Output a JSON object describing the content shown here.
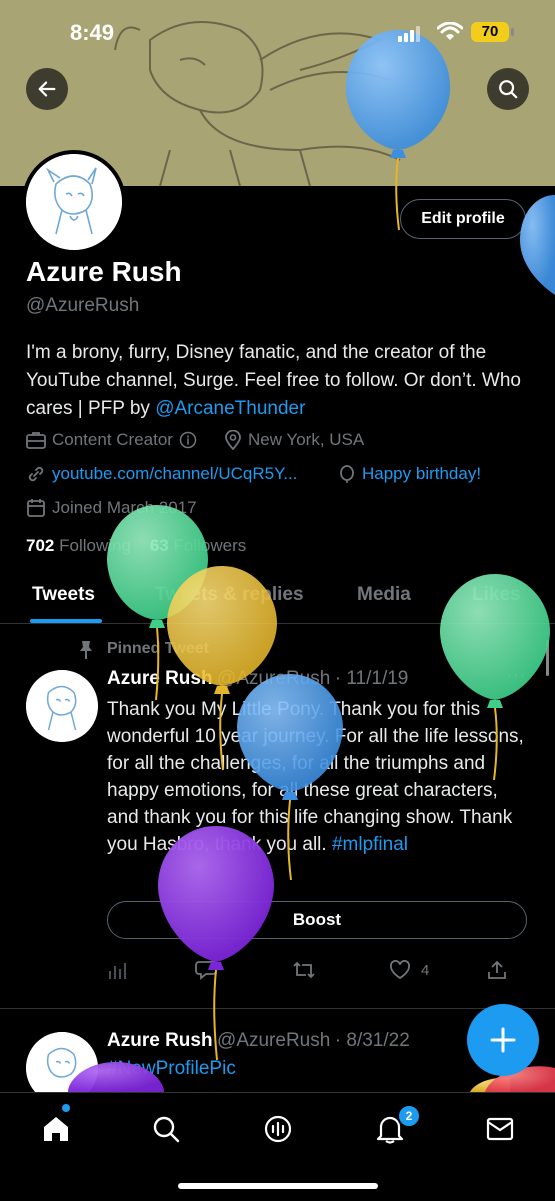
{
  "status_bar": {
    "time": "8:49",
    "battery": "70"
  },
  "profile": {
    "name": "Azure Rush",
    "handle": "@AzureRush",
    "bio_text": "I'm a brony, furry, Disney fanatic, and the creator of the YouTube channel, Surge. Feel free to follow. Or don’t. Who cares | PFP by ",
    "bio_mention": "@ArcaneThunder",
    "category": "Content Creator",
    "location": "New York, USA",
    "website": "youtube.com/channel/UCqR5Y...",
    "birthday": "Happy birthday!",
    "joined": "Joined March 2017",
    "following_count": "702",
    "following_label": "Following",
    "followers_count": "63",
    "followers_label": "Followers",
    "edit_label": "Edit profile"
  },
  "tabs": [
    {
      "label": "Tweets"
    },
    {
      "label": "Tweets & replies"
    },
    {
      "label": "Media"
    },
    {
      "label": "Likes"
    }
  ],
  "tweets": [
    {
      "pinned_label": "Pinned Tweet",
      "name": "Azure Rush",
      "handle": "@AzureRush",
      "date": "· 11/1/19",
      "text": "Thank you My Little Pony. Thank you for this wonderful 10 year journey. For all the life lessons, for all the challenges, for all the triumphs and happy emotions, for all these great characters, and thank you for this life changing show. Thank you Hasbro, thank you all. ",
      "hashtag": "#mlpfinal",
      "boost_label": "Boost",
      "likes": "4"
    },
    {
      "name": "Azure Rush",
      "handle": "@AzureRush",
      "date": "· 8/31/22",
      "hashtag": "#NewProfilePic"
    }
  ],
  "nav": {
    "notifications_badge": "2"
  },
  "colors": {
    "accent": "#1d9bf0",
    "background": "#000000",
    "secondary_text": "#71767b"
  }
}
